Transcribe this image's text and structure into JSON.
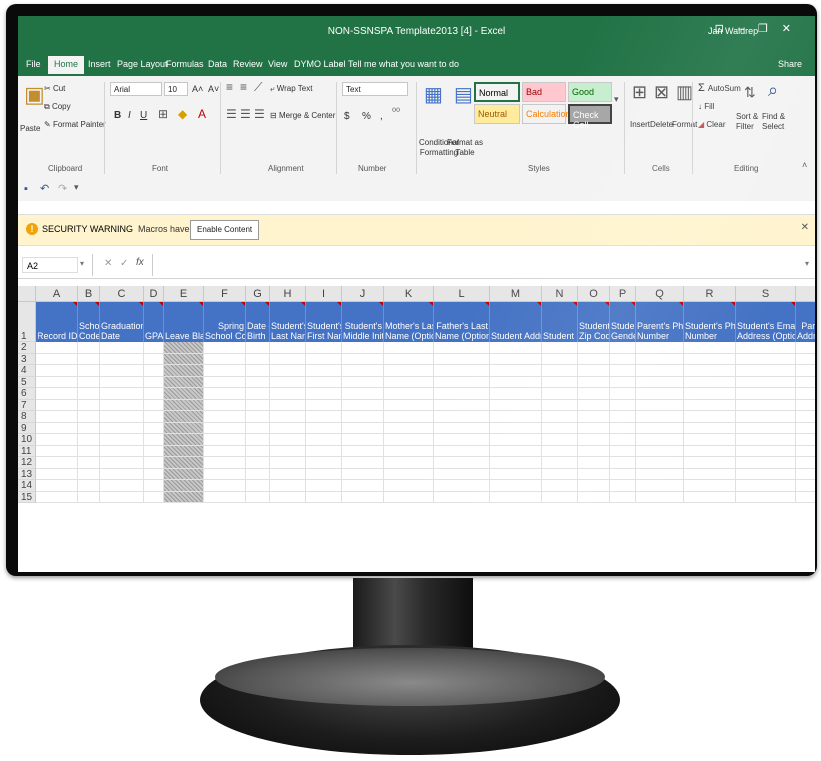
{
  "window": {
    "title": "NON-SSNSPA Template2013 [4] - Excel",
    "user": "Jan Waldrep",
    "controls": [
      "⊡",
      "–",
      "❐",
      "✕"
    ]
  },
  "tabs": [
    "File",
    "Home",
    "Insert",
    "Page Layout",
    "Formulas",
    "Data",
    "Review",
    "View",
    "DYMO Label"
  ],
  "tell_me": "Tell me what you want to do",
  "share": "Share",
  "ribbon": {
    "clipboard": {
      "paste": "Paste",
      "cut": "Cut",
      "copy": "Copy",
      "format_painter": "Format Painter",
      "group": "Clipboard"
    },
    "font": {
      "name": "Arial",
      "size": "10",
      "group": "Font",
      "bold": "B",
      "italic": "I",
      "underline": "U",
      "grow": "A˄",
      "shrink": "A˅"
    },
    "alignment": {
      "wrap": "Wrap Text",
      "merge": "Merge & Center",
      "group": "Alignment"
    },
    "number": {
      "format": "Text",
      "dollar": "$",
      "percent": "%",
      "comma": ",",
      "group": "Number"
    },
    "styles": {
      "conditional": "Conditional Formatting",
      "format_as_table": "Format as Table",
      "cells": [
        {
          "label": "Normal",
          "bg": "#ffffff",
          "fg": "#000000"
        },
        {
          "label": "Bad",
          "bg": "#ffc7ce",
          "fg": "#9c0006"
        },
        {
          "label": "Good",
          "bg": "#c6efce",
          "fg": "#006100"
        },
        {
          "label": "Neutral",
          "bg": "#ffeb9c",
          "fg": "#9c5700"
        },
        {
          "label": "Calculation",
          "bg": "#f2f2f2",
          "fg": "#fa7d00"
        },
        {
          "label": "Check Cell",
          "bg": "#a5a5a5",
          "fg": "#ffffff"
        }
      ],
      "group": "Styles"
    },
    "cells": {
      "insert": "Insert",
      "delete": "Delete",
      "format": "Format",
      "group": "Cells"
    },
    "editing": {
      "autosum": "AutoSum",
      "fill": "Fill",
      "clear": "Clear",
      "sort": "Sort & Filter",
      "find": "Find & Select",
      "group": "Editing"
    }
  },
  "security": {
    "label": "SECURITY WARNING",
    "message": "Macros have been disabled.",
    "button": "Enable Content"
  },
  "formula_bar": {
    "name_box": "A2",
    "cancel": "✕",
    "enter": "✓",
    "fx": "fx",
    "value": ""
  },
  "sheet": {
    "columns": [
      "A",
      "B",
      "C",
      "D",
      "E",
      "F",
      "G",
      "H",
      "I",
      "J",
      "K",
      "L",
      "M",
      "N",
      "O",
      "P",
      "Q",
      "R",
      "S",
      ""
    ],
    "headers": [
      [
        "Record ID"
      ],
      [
        "School",
        "Code"
      ],
      [
        "Graduation",
        "Date"
      ],
      [
        "GPA"
      ],
      [
        "Leave Blank"
      ],
      [
        "Spring",
        "School Code"
      ],
      [
        "Date of",
        "Birth"
      ],
      [
        "Student's",
        "Last Name"
      ],
      [
        "Student's",
        "First Name"
      ],
      [
        "Student's",
        "Middle Initial"
      ],
      [
        "Mother's Last",
        "Name (Optional)"
      ],
      [
        "Father's Last",
        "Name (Optional)"
      ],
      [
        "Student Address"
      ],
      [
        "Student City"
      ],
      [
        "Student",
        "Zip Code"
      ],
      [
        "Student",
        "Gender"
      ],
      [
        "Parent's Phone",
        "Number"
      ],
      [
        "Student's Phone",
        "Number"
      ],
      [
        "Student's Email",
        "Address (Optional)"
      ],
      [
        "Parent's",
        "Address"
      ]
    ],
    "rows": [
      "1",
      "2",
      "3",
      "4",
      "5",
      "6",
      "7",
      "8",
      "9",
      "10",
      "11",
      "12",
      "13",
      "14",
      "15"
    ],
    "header_color": "#4472c4",
    "blank_column": "E"
  }
}
